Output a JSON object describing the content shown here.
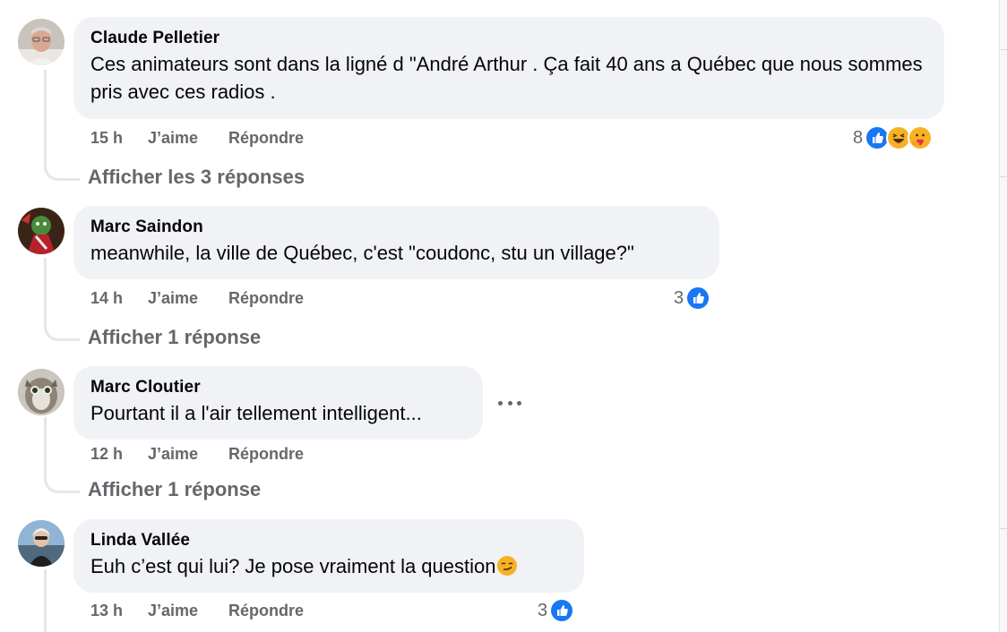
{
  "comments": [
    {
      "author": "Claude Pelletier",
      "text": "Ces animateurs sont dans la ligné d \"André Arthur . Ça fait 40 ans a Québec que nous sommes pris avec ces radios .",
      "time": "15 h",
      "like_label": "J’aime",
      "reply_label": "Répondre",
      "reaction_count": "8",
      "reactions": [
        "like-icon",
        "laugh-icon",
        "care-icon"
      ],
      "replies_label": "Afficher les 3 réponses"
    },
    {
      "author": "Marc Saindon",
      "text": "meanwhile, la ville de Québec, c'est \"coudonc, stu un village?\"",
      "time": "14 h",
      "like_label": "J’aime",
      "reply_label": "Répondre",
      "reaction_count": "3",
      "reactions": [
        "like-icon"
      ],
      "replies_label": "Afficher 1 réponse"
    },
    {
      "author": "Marc Cloutier",
      "text": "Pourtant il a l'air tellement intelligent...",
      "time": "12 h",
      "like_label": "J’aime",
      "reply_label": "Répondre",
      "replies_label": "Afficher 1 réponse"
    },
    {
      "author": "Linda Vallée",
      "text": "Euh c’est qui lui? Je pose vraiment la question",
      "text_emoji": "smirk-emoji",
      "time": "13 h",
      "like_label": "J’aime",
      "reply_label": "Répondre",
      "reaction_count": "3",
      "reactions": [
        "like-icon"
      ]
    }
  ],
  "colors": {
    "bubble": "#f0f2f5",
    "secondary_text": "#65676b",
    "like_blue": "#1877f2",
    "thread_line": "#e4e6eb"
  }
}
